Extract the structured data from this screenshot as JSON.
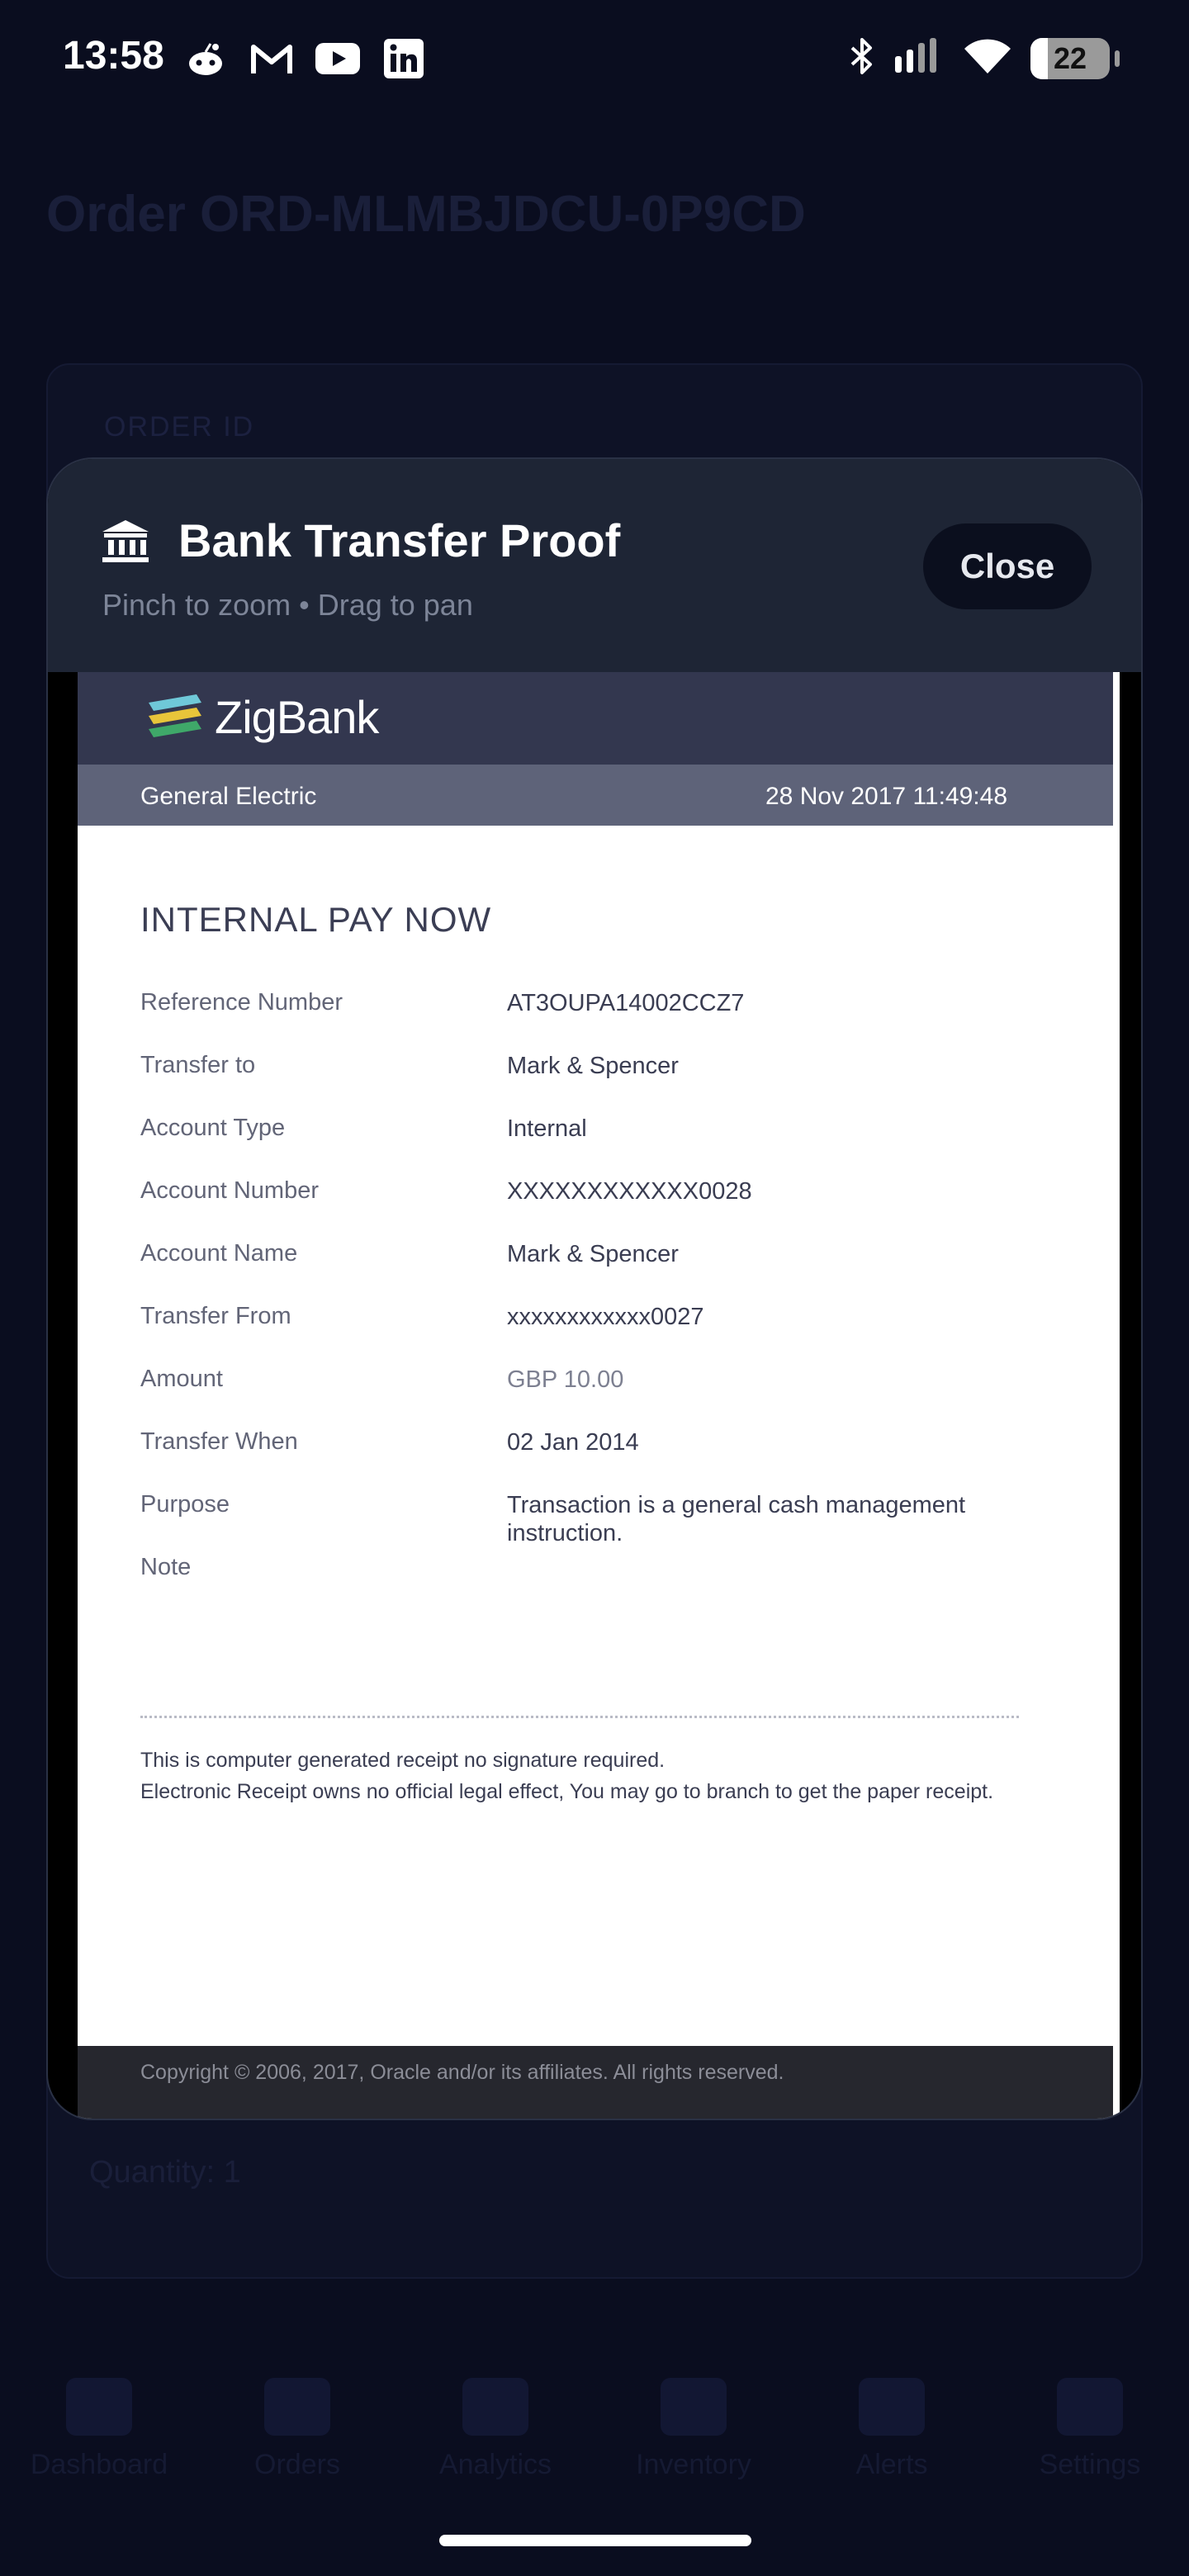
{
  "status_bar": {
    "time": "13:58",
    "notification_icons": [
      "reddit-icon",
      "gmail-icon",
      "youtube-icon",
      "linkedin-icon"
    ],
    "battery": "22",
    "battery_level_percent": 22
  },
  "background": {
    "order_title": "Order ORD-MLMBJDCU-0P9CD",
    "order_id_label": "ORDER ID",
    "quantity": "Quantity: 1",
    "nav": [
      {
        "label": "Dashboard"
      },
      {
        "label": "Orders"
      },
      {
        "label": "Analytics"
      },
      {
        "label": "Inventory"
      },
      {
        "label": "Alerts"
      },
      {
        "label": "Settings"
      }
    ]
  },
  "modal": {
    "title": "Bank Transfer Proof",
    "subtitle": "Pinch to zoom • Drag to pan",
    "close_label": "Close",
    "icon": "bank-icon"
  },
  "receipt": {
    "brand": "ZigBank",
    "company": "General Electric",
    "datetime": "28 Nov 2017 11:49:48",
    "heading": "INTERNAL PAY NOW",
    "rows": [
      {
        "label": "Reference Number",
        "value": "AT3OUPA14002CCZ7"
      },
      {
        "label": "Transfer to",
        "value": "Mark & Spencer"
      },
      {
        "label": "Account Type",
        "value": "Internal"
      },
      {
        "label": "Account Number",
        "value": "XXXXXXXXXXXX0028"
      },
      {
        "label": "Account Name",
        "value": "Mark & Spencer"
      },
      {
        "label": "Transfer From",
        "value": "xxxxxxxxxxxx0027"
      },
      {
        "label": "Amount",
        "value": "GBP 10.00"
      },
      {
        "label": "Transfer When",
        "value": "02 Jan 2014"
      },
      {
        "label": "Purpose",
        "value": "Transaction is a general cash management instruction."
      },
      {
        "label": "Note",
        "value": ""
      }
    ],
    "footer_line1": "This is computer generated receipt no signature required.",
    "footer_line2": "Electronic Receipt owns no official legal effect, You may go to branch to get the paper receipt.",
    "copyright": "Copyright © 2006, 2017, Oracle and/or its affiliates. All rights reserved."
  },
  "colors": {
    "background": "#0a0d1f",
    "modal_header": "#1e2535",
    "receipt_brand_bar": "#33374f",
    "receipt_sub_bar": "#5e6379"
  }
}
